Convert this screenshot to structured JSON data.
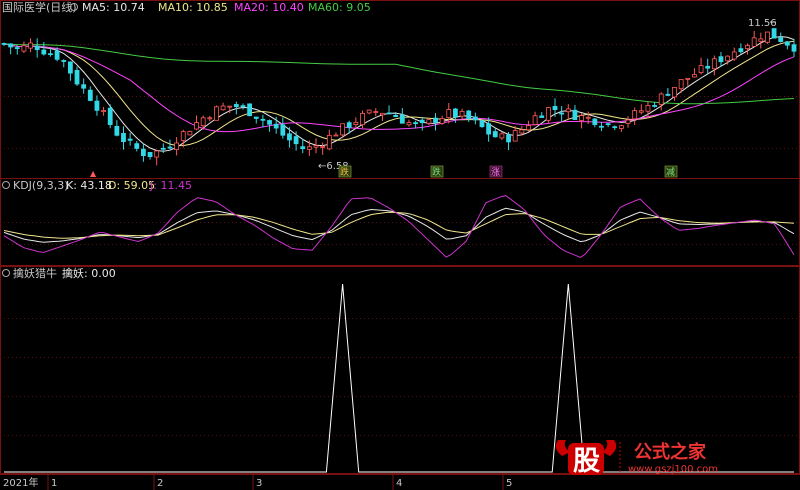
{
  "colors": {
    "background": "#000000",
    "panel_border": "#7a1010",
    "grid": "#5a1212",
    "up": "#ff5a5a",
    "down": "#33d8e6",
    "ma5": "#e8e8e8",
    "ma10": "#f0e68c",
    "ma20": "#ff44ff",
    "ma60": "#44cc44",
    "k": "#e8e8e8",
    "d": "#f0e68c",
    "j": "#cc33cc",
    "signal": "#ffffff",
    "header_text": "#c8c8c8",
    "logo_red": "#cc0000",
    "logo_url": "#ee3333"
  },
  "main_panel": {
    "title": "国际医学(日线)",
    "indicators": [
      {
        "name": "MA5",
        "value": "10.74",
        "color": "#e8e8e8"
      },
      {
        "name": "MA10",
        "value": "10.85",
        "color": "#f0e68c"
      },
      {
        "name": "MA20",
        "value": "10.40",
        "color": "#ff44ff"
      },
      {
        "name": "MA60",
        "value": "9.05",
        "color": "#44cc44"
      }
    ],
    "high_label": "11.56",
    "low_label": "6.58",
    "markers": [
      "跌",
      "跌",
      "涨",
      "减"
    ]
  },
  "kdj_panel": {
    "title": "KDJ(9,3,3)",
    "k": "K: 43.18",
    "d": "D: 59.05",
    "j": "J: 11.45"
  },
  "signal_panel": {
    "title": "擒妖猎牛",
    "value": "擒妖: 0.00"
  },
  "x_axis": {
    "labels": [
      "2021年",
      "1",
      "2",
      "3",
      "4",
      "5"
    ]
  },
  "logo": {
    "badge": "股",
    "title": "公式之家",
    "url": "www.gszj100.com"
  },
  "chart_data": [
    {
      "type": "candlestick",
      "title": "国际医学(日线)",
      "series": [
        {
          "name": "MA5",
          "values": [
            10.74
          ]
        },
        {
          "name": "MA10",
          "values": [
            10.85
          ]
        },
        {
          "name": "MA20",
          "values": [
            10.4
          ]
        },
        {
          "name": "MA60",
          "values": [
            9.05
          ]
        }
      ],
      "annotations": [
        {
          "text": "11.56",
          "kind": "high"
        },
        {
          "text": "6.58",
          "kind": "low"
        }
      ],
      "ylim": [
        6.3,
        11.9
      ],
      "close_trend": [
        10.9,
        10.7,
        10.9,
        10.6,
        10.4,
        9.6,
        9.0,
        8.3,
        7.6,
        7.2,
        6.9,
        7.1,
        7.5,
        7.9,
        8.3,
        8.6,
        8.7,
        8.5,
        8.2,
        7.8,
        7.4,
        7.1,
        7.3,
        7.7,
        8.0,
        8.3,
        8.5,
        8.4,
        8.1,
        7.9,
        8.2,
        8.4,
        8.3,
        8.0,
        7.6,
        7.5,
        7.8,
        8.3,
        8.6,
        8.5,
        8.3,
        8.2,
        8.0,
        8.1,
        8.4,
        8.7,
        9.1,
        9.5,
        9.8,
        10.1,
        10.4,
        10.7,
        11.0,
        11.3,
        11.1,
        10.8
      ]
    },
    {
      "type": "line",
      "title": "KDJ(9,3,3)",
      "series": [
        {
          "name": "K",
          "values": [
            45,
            35,
            30,
            32,
            36,
            42,
            40,
            37,
            42,
            60,
            75,
            78,
            72,
            64,
            52,
            40,
            34,
            48,
            72,
            80,
            78,
            70,
            54,
            34,
            40,
            68,
            82,
            76,
            58,
            42,
            30,
            42,
            64,
            76,
            68,
            58,
            57,
            58,
            60,
            62,
            60,
            43
          ]
        },
        {
          "name": "D",
          "values": [
            48,
            42,
            38,
            36,
            37,
            40,
            41,
            40,
            41,
            52,
            64,
            72,
            72,
            68,
            60,
            50,
            42,
            45,
            60,
            72,
            76,
            74,
            64,
            48,
            44,
            58,
            72,
            74,
            66,
            54,
            42,
            42,
            54,
            66,
            68,
            63,
            60,
            59,
            60,
            61,
            61,
            59
          ]
        },
        {
          "name": "J",
          "values": [
            40,
            22,
            14,
            24,
            34,
            46,
            38,
            31,
            44,
            76,
            98,
            92,
            72,
            56,
            36,
            20,
            18,
            54,
            96,
            98,
            82,
            62,
            34,
            6,
            32,
            90,
            102,
            80,
            42,
            18,
            6,
            42,
            84,
            96,
            68,
            48,
            51,
            56,
            60,
            64,
            58,
            11
          ]
        }
      ]
    },
    {
      "type": "line",
      "title": "擒妖猎牛",
      "series": [
        {
          "name": "擒妖",
          "values": [
            0,
            0,
            0,
            0,
            0,
            0,
            0,
            0,
            0,
            0,
            0,
            0,
            0,
            0,
            0,
            0,
            0,
            0,
            0,
            0,
            0,
            1,
            0,
            0,
            0,
            0,
            0,
            0,
            0,
            0,
            0,
            0,
            0,
            0,
            0,
            1,
            0,
            0,
            0,
            0,
            0,
            0,
            0,
            0,
            0,
            0,
            0,
            0,
            0,
            0
          ]
        }
      ],
      "ylim": [
        0,
        1
      ]
    }
  ]
}
